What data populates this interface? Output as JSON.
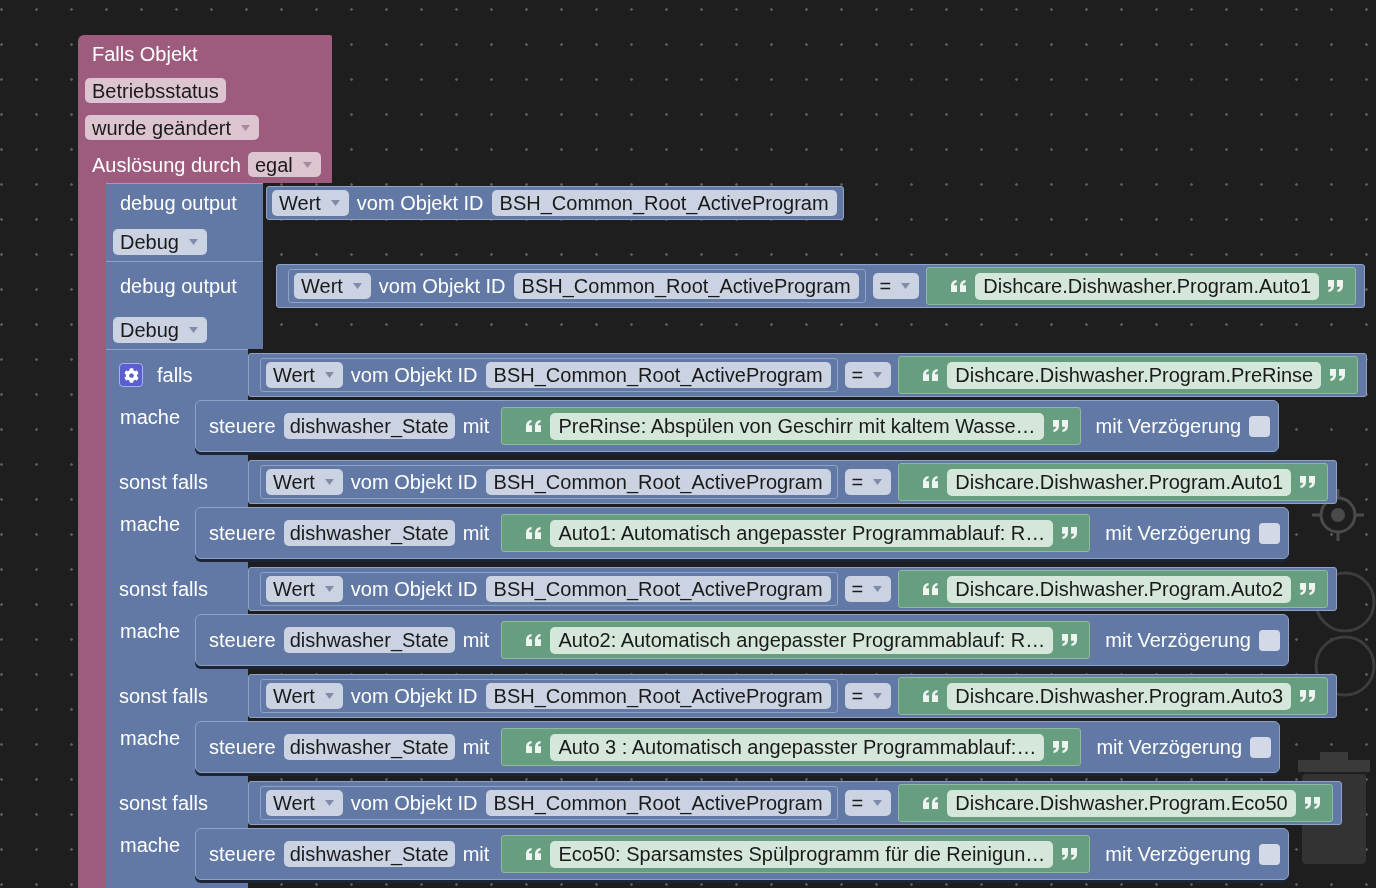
{
  "event_block": {
    "title": "Falls Objekt",
    "object": "Betriebsstatus",
    "condition": "wurde geändert",
    "trigger_label": "Auslösung durch",
    "trigger": "egal",
    "statements": [
      {
        "kind": "debug",
        "label": "debug output",
        "value": {
          "kind": "get",
          "attribute": "Wert",
          "of_label": "vom Objekt ID",
          "object_id": "BSH_Common_Root_ActiveProgram"
        },
        "log_type": "Debug"
      },
      {
        "kind": "debug",
        "label": "debug output",
        "value": {
          "kind": "compare",
          "left": {
            "kind": "get",
            "attribute": "Wert",
            "of_label": "vom Objekt ID",
            "object_id": "BSH_Common_Root_ActiveProgram"
          },
          "operator": "=",
          "right": {
            "kind": "text",
            "text": "Dishcare.Dishwasher.Program.Auto1"
          }
        },
        "log_type": "Debug"
      },
      {
        "kind": "if",
        "branches": [
          {
            "label": "falls",
            "condition": {
              "kind": "compare",
              "left": {
                "kind": "get",
                "attribute": "Wert",
                "of_label": "vom Objekt ID",
                "object_id": "BSH_Common_Root_ActiveProgram"
              },
              "operator": "=",
              "right": {
                "kind": "text",
                "text": "Dishcare.Dishwasher.Program.PreRinse"
              }
            },
            "do_label": "mache",
            "action": {
              "kind": "set_state",
              "label": "steuere",
              "object": "dishwasher_State",
              "with_label": "mit",
              "value": {
                "kind": "text",
                "text": "PreRinse: Abspülen von Geschirr mit kaltem Wasse…"
              },
              "delay_label": "mit Verzögerung",
              "delay_checked": false
            }
          },
          {
            "label": "sonst falls",
            "condition": {
              "kind": "compare",
              "left": {
                "kind": "get",
                "attribute": "Wert",
                "of_label": "vom Objekt ID",
                "object_id": "BSH_Common_Root_ActiveProgram"
              },
              "operator": "=",
              "right": {
                "kind": "text",
                "text": "Dishcare.Dishwasher.Program.Auto1"
              }
            },
            "do_label": "mache",
            "action": {
              "kind": "set_state",
              "label": "steuere",
              "object": "dishwasher_State",
              "with_label": "mit",
              "value": {
                "kind": "text",
                "text": "Auto1: Automatisch angepasster Programmablauf: R…"
              },
              "delay_label": "mit Verzögerung",
              "delay_checked": false
            }
          },
          {
            "label": "sonst falls",
            "condition": {
              "kind": "compare",
              "left": {
                "kind": "get",
                "attribute": "Wert",
                "of_label": "vom Objekt ID",
                "object_id": "BSH_Common_Root_ActiveProgram"
              },
              "operator": "=",
              "right": {
                "kind": "text",
                "text": "Dishcare.Dishwasher.Program.Auto2"
              }
            },
            "do_label": "mache",
            "action": {
              "kind": "set_state",
              "label": "steuere",
              "object": "dishwasher_State",
              "with_label": "mit",
              "value": {
                "kind": "text",
                "text": "Auto2: Automatisch angepasster Programmablauf: R…"
              },
              "delay_label": "mit Verzögerung",
              "delay_checked": false
            }
          },
          {
            "label": "sonst falls",
            "condition": {
              "kind": "compare",
              "left": {
                "kind": "get",
                "attribute": "Wert",
                "of_label": "vom Objekt ID",
                "object_id": "BSH_Common_Root_ActiveProgram"
              },
              "operator": "=",
              "right": {
                "kind": "text",
                "text": "Dishcare.Dishwasher.Program.Auto3"
              }
            },
            "do_label": "mache",
            "action": {
              "kind": "set_state",
              "label": "steuere",
              "object": "dishwasher_State",
              "with_label": "mit",
              "value": {
                "kind": "text",
                "text": "Auto 3 : Automatisch angepasster Programmablauf:…"
              },
              "delay_label": "mit Verzögerung",
              "delay_checked": false
            }
          },
          {
            "label": "sonst falls",
            "condition": {
              "kind": "compare",
              "left": {
                "kind": "get",
                "attribute": "Wert",
                "of_label": "vom Objekt ID",
                "object_id": "BSH_Common_Root_ActiveProgram"
              },
              "operator": "=",
              "right": {
                "kind": "text",
                "text": "Dishcare.Dishwasher.Program.Eco50"
              }
            },
            "do_label": "mache",
            "action": {
              "kind": "set_state",
              "label": "steuere",
              "object": "dishwasher_State",
              "with_label": "mit",
              "value": {
                "kind": "text",
                "text": "Eco50: Sparsamstes Spülprogramm für die Reinigun…"
              },
              "delay_label": "mit Verzögerung",
              "delay_checked": false
            }
          }
        ]
      }
    ]
  }
}
